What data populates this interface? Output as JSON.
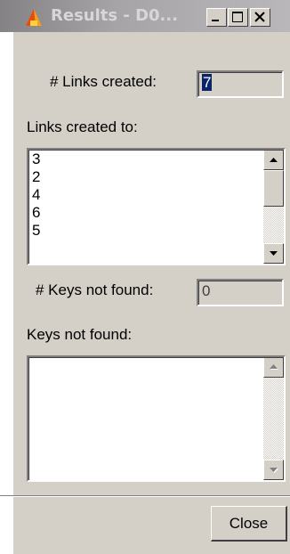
{
  "window": {
    "title": "Results - D0...",
    "icon": "app-icon",
    "controls": [
      "minimize-icon",
      "maximize-icon",
      "close-icon"
    ]
  },
  "links_created": {
    "label": "# Links created:",
    "value": "7"
  },
  "links_created_to": {
    "label": "Links created to:",
    "items": [
      "3",
      "2",
      "4",
      "6",
      "5"
    ]
  },
  "keys_not_found_count": {
    "label": "# Keys not found:",
    "value": "0"
  },
  "keys_not_found": {
    "label": "Keys not found:",
    "items": []
  },
  "buttons": {
    "close_label": "Close"
  },
  "colors": {
    "face": "#d4d0c8",
    "selection": "#0a246a"
  }
}
